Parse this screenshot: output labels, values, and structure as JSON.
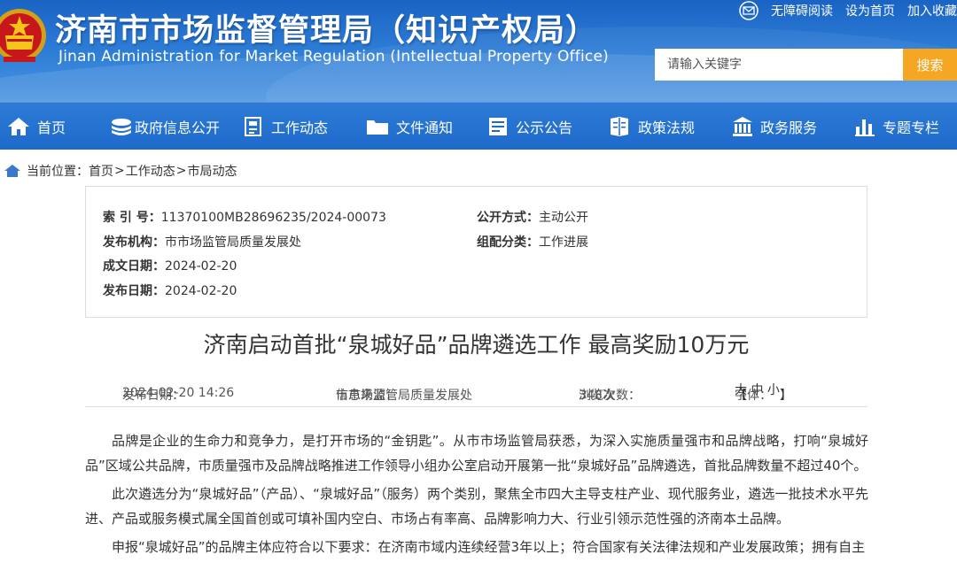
{
  "header": {
    "title": "济南市市场监督管理局（知识产权局）",
    "subtitle": "Jinan Administration for Market Regulation (Intellectual Property Office)",
    "top_links": {
      "accessibility": "无障碍阅读",
      "set_home": "设为首页",
      "favorite": "加入收藏"
    },
    "search": {
      "placeholder": "请输入关键字",
      "button": "搜索"
    }
  },
  "nav": {
    "items": [
      {
        "label": "首页",
        "icon": "home-icon"
      },
      {
        "label": "政府信息公开",
        "icon": "stack-icon"
      },
      {
        "label": "工作动态",
        "icon": "document-icon"
      },
      {
        "label": "文件通知",
        "icon": "folder-icon"
      },
      {
        "label": "公示公告",
        "icon": "notice-icon"
      },
      {
        "label": "政策法规",
        "icon": "law-icon"
      },
      {
        "label": "政务服务",
        "icon": "building-icon"
      },
      {
        "label": "专题专栏",
        "icon": "bar-chart-icon"
      }
    ]
  },
  "breadcrumb": {
    "prefix": "当前位置：",
    "items": [
      "首页",
      "工作动态",
      "市局动态"
    ],
    "separator": ">"
  },
  "meta": {
    "index_label": "索 引 号：",
    "index_value": "11370100MB28696235/2024-00073",
    "public_label": "公开方式：",
    "public_value": "主动公开",
    "org_label": "发布机构：",
    "org_value": "市市场监管局质量发展处",
    "category_label": "组配分类：",
    "category_value": "工作进展",
    "created_label": "成文日期：",
    "created_value": "2024-02-20",
    "published_label": "发布日期：",
    "published_value": "2024-02-20"
  },
  "article": {
    "title": "济南启动首批“泉城好品”品牌遴选工作 最高奖励10万元",
    "date_label": "发布日期：",
    "date_value": "2024-02-20 14:26",
    "source_label": "信息来源：",
    "source_value": "市市场监管局质量发展处",
    "views_label": "浏览次数：",
    "views_value": "348次",
    "font_label": "字体：",
    "font_open": "【",
    "font_large": "大",
    "font_medium": "中",
    "font_small": "小",
    "font_close": "】",
    "paragraphs": [
      "品牌是企业的生命力和竞争力，是打开市场的“金钥匙”。从市市场监管局获悉，为深入实施质量强市和品牌战略，打响“泉城好品”区域公共品牌，市质量强市及品牌战略推进工作领导小组办公室启动开展第一批“泉城好品”品牌遴选，首批品牌数量不超过40个。",
      "此次遴选分为“泉城好品”（产品）、“泉城好品”（服务）两个类别，聚焦全市四大主导支柱产业、现代服务业，遴选一批技术水平先进、产品或服务模式属全国首创或可填补国内空白、市场占有率高、品牌影响力大、行业引领示范性强的济南本土品牌。",
      "申报“泉城好品”的品牌主体应符合以下要求：在济南市域内连续经营3年以上；符合国家有关法律法规和产业发展政策；拥有自主"
    ]
  },
  "colors": {
    "header_blue": "#1a63c4",
    "nav_blue": "#1e6acb",
    "search_orange": "#f5a623"
  }
}
